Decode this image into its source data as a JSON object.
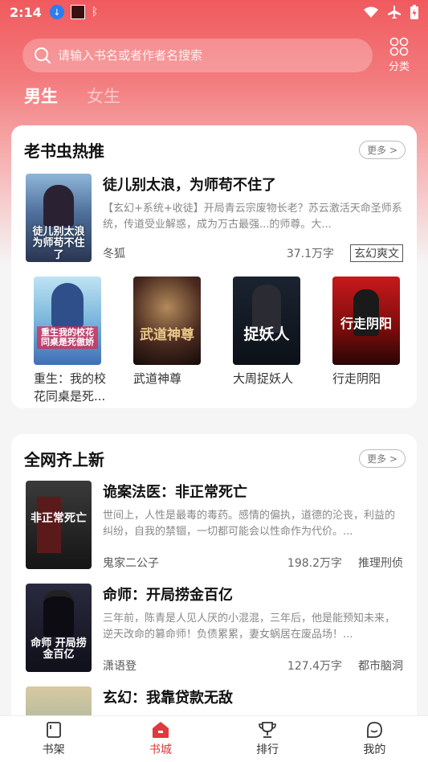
{
  "status": {
    "time": "2:14"
  },
  "search": {
    "placeholder": "请输入书名或者作者名搜索"
  },
  "category_label": "分类",
  "gender_tabs": [
    {
      "label": "男生",
      "active": true
    },
    {
      "label": "女生",
      "active": false
    }
  ],
  "section1": {
    "title": "老书虫热推",
    "more": "更多 >",
    "featured": {
      "title": "徒儿别太浪，为师苟不住了",
      "desc": "【玄幻+系统+收徒】开局青云宗废物长老？苏云激活天命圣师系统，传道受业解惑，成为万古最强...的师尊。大...",
      "author": "冬狐",
      "words": "37.1万字",
      "tag": "玄幻爽文",
      "cover_text": "徒儿别太浪 为师苟不住了"
    },
    "grid": [
      {
        "title": "重生：我的校花同桌是死...",
        "cover_text": "重生我的校花同桌是死傲娇"
      },
      {
        "title": "武道神尊",
        "cover_text": "武道神尊"
      },
      {
        "title": "大周捉妖人",
        "cover_text": "捉妖人"
      },
      {
        "title": "行走阴阳",
        "cover_text": "行走阴阳"
      }
    ]
  },
  "section2": {
    "title": "全网齐上新",
    "more": "更多 >",
    "items": [
      {
        "title": "诡案法医：非正常死亡",
        "desc": "世间上，人性是最毒的毒药。感情的偏执，道德的沦丧，利益的纠纷，自我的禁锢，一切都可能会以性命作为代价。...",
        "author": "鬼家二公子",
        "words": "198.2万字",
        "tag": "推理刑侦",
        "cover_text": "非正常死亡"
      },
      {
        "title": "命师：开局捞金百亿",
        "desc": "三年前，陈青是人见人厌的小混混，三年后，他是能预知未来，逆天改命的篡命师！负债累累，妻女蜗居在废品场！...",
        "author": "潇语登",
        "words": "127.4万字",
        "tag": "都市脑洞",
        "cover_text": "命师 开局捞金百亿"
      },
      {
        "title": "玄幻：我靠贷款无敌",
        "cover_text": ""
      }
    ]
  },
  "nav": [
    {
      "label": "书架",
      "icon": "bookshelf-icon"
    },
    {
      "label": "书城",
      "icon": "store-icon",
      "active": true
    },
    {
      "label": "排行",
      "icon": "trophy-icon"
    },
    {
      "label": "我的",
      "icon": "profile-icon"
    }
  ],
  "colors": {
    "accent": "#e0393e",
    "header": "#f05a5e"
  }
}
